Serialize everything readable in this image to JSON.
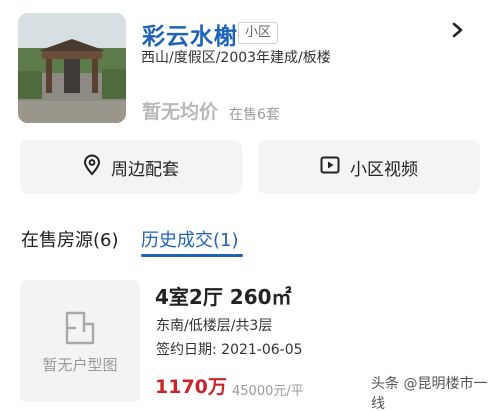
{
  "community": {
    "name": "彩云水榭",
    "tag": "小区",
    "info": "西山/度假区/2003年建成/板楼",
    "avg_price": "暂无均价",
    "on_sale": "在售6套"
  },
  "actions": [
    {
      "label": "周边配套",
      "icon": "location-pin-icon"
    },
    {
      "label": "小区视频",
      "icon": "video-play-icon"
    }
  ],
  "tabs": {
    "on_sale": "在售房源(6)",
    "history": "历史成交(1)",
    "active": "history"
  },
  "listing": {
    "plan_placeholder": "暂无户型图",
    "layout": "4室2厅 260㎡",
    "meta": "东南/低楼层/共3层",
    "sign_date": "签约日期: 2021-06-05",
    "total_price": "1170万",
    "unit_price": "45000元/平"
  },
  "watermark": {
    "text": "头条 @昆明楼市一线"
  },
  "colors": {
    "accent": "#1f63b8",
    "price": "#c8242a"
  }
}
